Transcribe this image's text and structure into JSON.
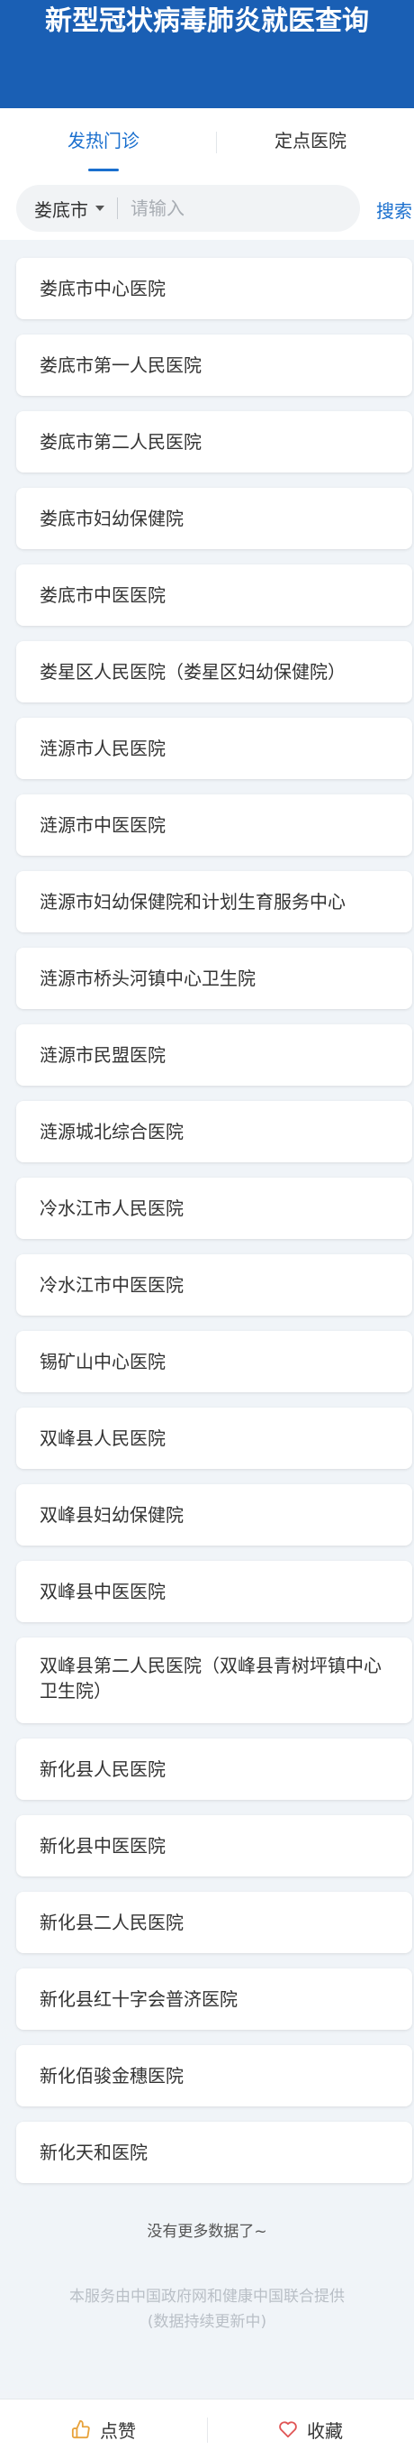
{
  "header": {
    "title": "新型冠状病毒肺炎就医查询"
  },
  "tabs": [
    {
      "label": "发热门诊",
      "active": true
    },
    {
      "label": "定点医院",
      "active": false
    }
  ],
  "search": {
    "city": "娄底市",
    "placeholder": "请输入",
    "value": "",
    "button_label": "搜索"
  },
  "hospitals": [
    "娄底市中心医院",
    "娄底市第一人民医院",
    "娄底市第二人民医院",
    "娄底市妇幼保健院",
    "娄底市中医医院",
    "娄星区人民医院（娄星区妇幼保健院）",
    "涟源市人民医院",
    "涟源市中医医院",
    "涟源市妇幼保健院和计划生育服务中心",
    "涟源市桥头河镇中心卫生院",
    "涟源市民盟医院",
    "涟源城北综合医院",
    "冷水江市人民医院",
    "冷水江市中医医院",
    "锡矿山中心医院",
    "双峰县人民医院",
    "双峰县妇幼保健院",
    "双峰县中医医院",
    "双峰县第二人民医院（双峰县青树坪镇中心卫生院）",
    "新化县人民医院",
    "新化县中医医院",
    "新化县二人民医院",
    "新化县红十字会普济医院",
    "新化佰骏金穗医院",
    "新化天和医院"
  ],
  "list_end": "没有更多数据了~",
  "provider": {
    "line1": "本服务由中国政府网和健康中国联合提供",
    "line2": "(数据持续更新中)"
  },
  "footer": {
    "like_label": "点赞",
    "favorite_label": "收藏",
    "like_icon": "thumbs-up-icon",
    "favorite_icon": "heart-icon"
  },
  "colors": {
    "header_bg": "#1a5fb4",
    "accent": "#1a6fce",
    "like_icon": "#e8a33d",
    "favorite_icon": "#e05555"
  }
}
